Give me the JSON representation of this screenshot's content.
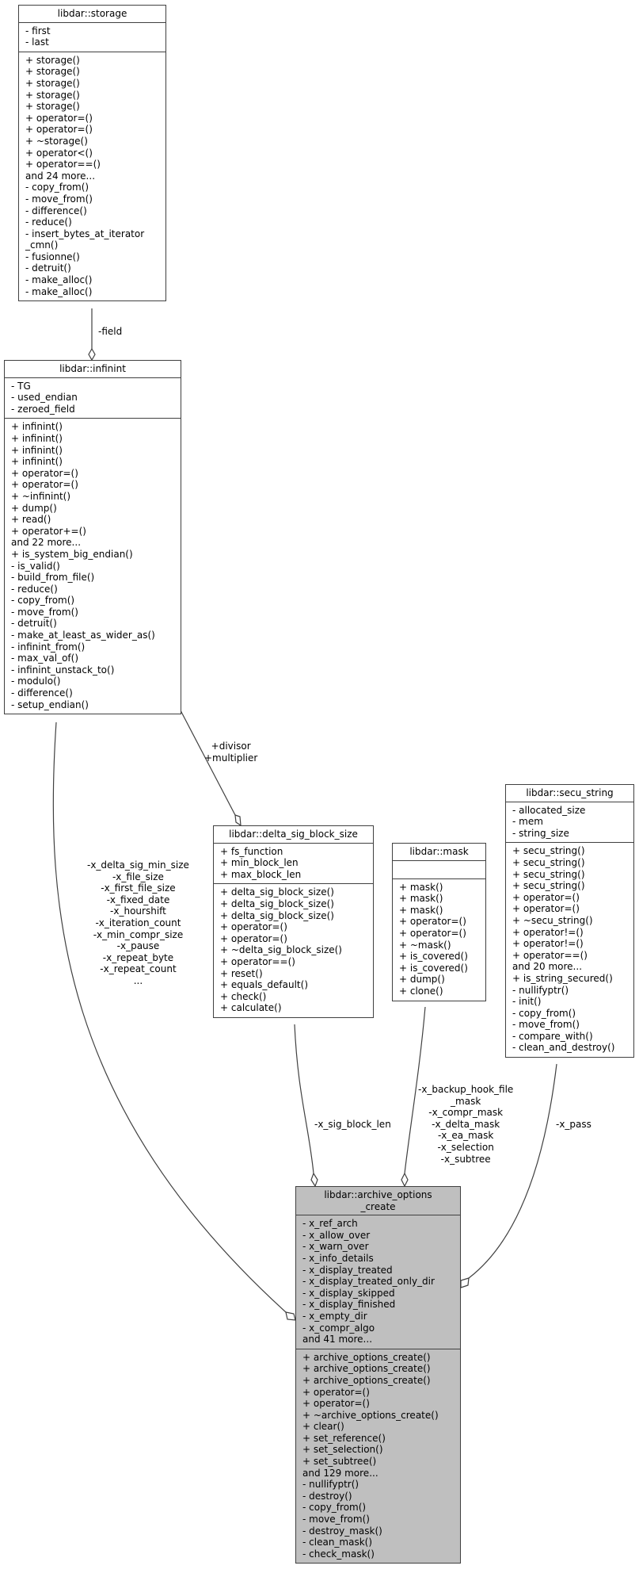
{
  "classes": {
    "storage": {
      "title": "libdar::storage",
      "attributes": [
        "- first",
        "- last"
      ],
      "methods": [
        "+ storage()",
        "+ storage()",
        "+ storage()",
        "+ storage()",
        "+ storage()",
        "+ operator=()",
        "+ operator=()",
        "+ ~storage()",
        "+ operator<()",
        "+ operator==()",
        "and 24 more...",
        "- copy_from()",
        "- move_from()",
        "- difference()",
        "- reduce()",
        "- insert_bytes_at_iterator",
        "_cmn()",
        "- fusionne()",
        "- detruit()",
        "- make_alloc()",
        "- make_alloc()"
      ]
    },
    "infinint": {
      "title": "libdar::infinint",
      "attributes": [
        "- TG",
        "- used_endian",
        "- zeroed_field"
      ],
      "methods": [
        "+ infinint()",
        "+ infinint()",
        "+ infinint()",
        "+ infinint()",
        "+ operator=()",
        "+ operator=()",
        "+ ~infinint()",
        "+ dump()",
        "+ read()",
        "+ operator+=()",
        "and 22 more...",
        "+ is_system_big_endian()",
        "- is_valid()",
        "- build_from_file()",
        "- reduce()",
        "- copy_from()",
        "- move_from()",
        "- detruit()",
        "- make_at_least_as_wider_as()",
        "- infinint_from()",
        "- max_val_of()",
        "- infinint_unstack_to()",
        "- modulo()",
        "- difference()",
        "- setup_endian()"
      ]
    },
    "delta_sig_block_size": {
      "title": "libdar::delta_sig_block_size",
      "attributes": [
        "+ fs_function",
        "+ min_block_len",
        "+ max_block_len"
      ],
      "methods": [
        "+ delta_sig_block_size()",
        "+ delta_sig_block_size()",
        "+ delta_sig_block_size()",
        "+ operator=()",
        "+ operator=()",
        "+ ~delta_sig_block_size()",
        "+ operator==()",
        "+ reset()",
        "+ equals_default()",
        "+ check()",
        "+ calculate()"
      ]
    },
    "mask": {
      "title": "libdar::mask",
      "attributes": [],
      "methods": [
        "+ mask()",
        "+ mask()",
        "+ mask()",
        "+ operator=()",
        "+ operator=()",
        "+ ~mask()",
        "+ is_covered()",
        "+ is_covered()",
        "+ dump()",
        "+ clone()"
      ]
    },
    "secu_string": {
      "title": "libdar::secu_string",
      "attributes": [
        "- allocated_size",
        "- mem",
        "- string_size"
      ],
      "methods": [
        "+ secu_string()",
        "+ secu_string()",
        "+ secu_string()",
        "+ secu_string()",
        "+ operator=()",
        "+ operator=()",
        "+ ~secu_string()",
        "+ operator!=()",
        "+ operator!=()",
        "+ operator==()",
        "and 20 more...",
        "+ is_string_secured()",
        "- nullifyptr()",
        "- init()",
        "- copy_from()",
        "- move_from()",
        "- compare_with()",
        "- clean_and_destroy()"
      ]
    },
    "archive_options_create": {
      "title_lines": [
        "libdar::archive_options",
        "_create"
      ],
      "attributes": [
        "- x_ref_arch",
        "- x_allow_over",
        "- x_warn_over",
        "- x_info_details",
        "- x_display_treated",
        "- x_display_treated_only_dir",
        "- x_display_skipped",
        "- x_display_finished",
        "- x_empty_dir",
        "- x_compr_algo",
        "and 41 more..."
      ],
      "methods": [
        "+ archive_options_create()",
        "+ archive_options_create()",
        "+ archive_options_create()",
        "+ operator=()",
        "+ operator=()",
        "+ ~archive_options_create()",
        "+ clear()",
        "+ set_reference()",
        "+ set_selection()",
        "+ set_subtree()",
        "and 129 more...",
        "- nullifyptr()",
        "- destroy()",
        "- copy_from()",
        "- move_from()",
        "- destroy_mask()",
        "- clean_mask()",
        "- check_mask()"
      ]
    }
  },
  "edges": {
    "storage_infinint": {
      "labels": [
        "-field"
      ]
    },
    "infinint_delta": {
      "labels": [
        "+divisor",
        "+multiplier"
      ]
    },
    "infinint_archive": {
      "labels": [
        "-x_delta_sig_min_size",
        "-x_file_size",
        "-x_first_file_size",
        "-x_fixed_date",
        "-x_hourshift",
        "-x_iteration_count",
        "-x_min_compr_size",
        "-x_pause",
        "-x_repeat_byte",
        "-x_repeat_count",
        "..."
      ]
    },
    "delta_archive": {
      "labels": [
        "-x_sig_block_len"
      ]
    },
    "mask_archive": {
      "labels": [
        "-x_backup_hook_file",
        "_mask",
        "-x_compr_mask",
        "-x_delta_mask",
        "-x_ea_mask",
        "-x_selection",
        "-x_subtree"
      ]
    },
    "secu_archive": {
      "labels": [
        "-x_pass"
      ]
    }
  },
  "colors": {
    "focus_fill": "#bfbfbf",
    "edge": "#404040"
  }
}
